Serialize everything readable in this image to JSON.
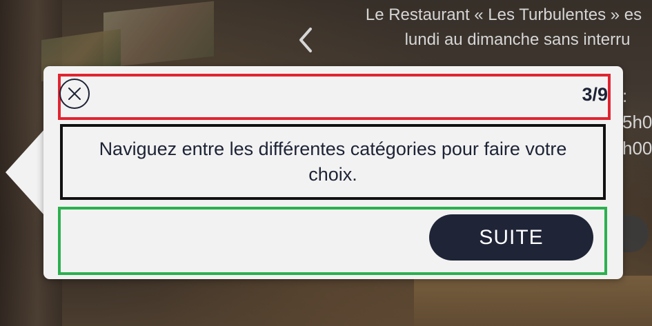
{
  "background": {
    "header_line1": "Le Restaurant « Les Turbulentes » es",
    "header_line2": "lundi au dimanche sans interru",
    "side_fragment_1": ":",
    "side_fragment_2": "5h0",
    "side_fragment_3": "h00"
  },
  "tutorial": {
    "step_counter": "3/9",
    "message": "Naviguez entre les différentes catégories pour faire votre choix.",
    "next_label": "SUITE",
    "close_icon": "close-icon"
  },
  "colors": {
    "header_outline": "#e02430",
    "body_outline": "#111111",
    "footer_outline": "#2bb04e",
    "button_bg": "#1f2437",
    "text": "#1d2336",
    "popover_bg": "#f2f2f2"
  }
}
